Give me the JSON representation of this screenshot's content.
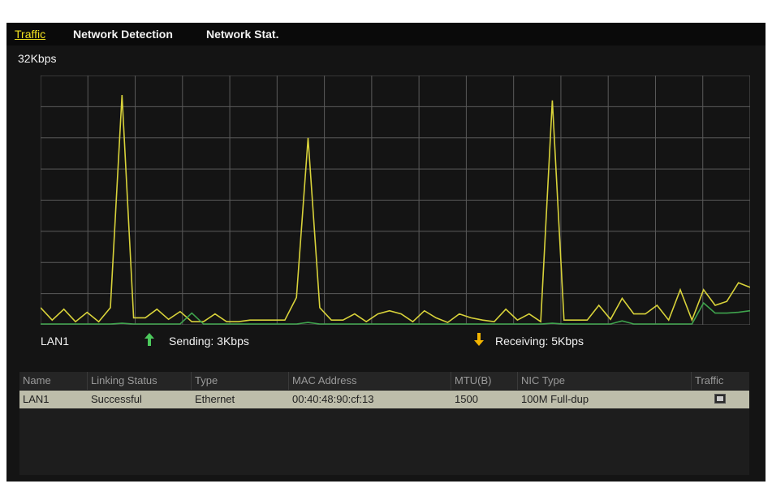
{
  "tabs": [
    {
      "label": "Traffic",
      "active": true
    },
    {
      "label": "Network Detection",
      "active": false
    },
    {
      "label": "Network Stat.",
      "active": false
    }
  ],
  "traffic": {
    "scale_label": "32Kbps",
    "interface": "LAN1",
    "sending_label": "Sending: 3Kbps",
    "receiving_label": "Receiving: 5Kbps",
    "sending_arrow_icon": "arrow-up-icon",
    "receiving_arrow_icon": "arrow-down-icon"
  },
  "chart_data": {
    "type": "line",
    "ylim": [
      0,
      32
    ],
    "y_unit": "Kbps",
    "x_count": 45,
    "grid": true,
    "series": [
      {
        "color": "#d8d23a",
        "values": [
          2.2,
          0.6,
          2.0,
          0.4,
          1.6,
          0.4,
          2.2,
          29.5,
          0.9,
          0.9,
          2.0,
          0.7,
          1.7,
          0.4,
          0.4,
          1.4,
          0.4,
          0.4,
          0.6,
          0.6,
          0.6,
          0.6,
          3.5,
          24.0,
          2.2,
          0.6,
          0.6,
          1.4,
          0.4,
          1.4,
          1.8,
          1.4,
          0.4,
          1.8,
          0.9,
          0.3,
          1.4,
          0.9,
          0.6,
          0.4,
          2.0,
          0.6,
          1.4,
          0.4,
          28.8
        ]
      },
      {
        "color": "#3fa34d",
        "values": [
          0.1,
          0.1,
          0.1,
          0.1,
          0.1,
          0.1,
          0.1,
          0.2,
          0.1,
          0.1,
          0.1,
          0.1,
          0.1,
          1.5,
          0.1,
          0.1,
          0.1,
          0.1,
          0.1,
          0.1,
          0.1,
          0.1,
          0.1,
          0.3,
          0.1,
          0.1,
          0.1,
          0.1,
          0.1,
          0.1,
          0.1,
          0.1,
          0.1,
          0.1,
          0.1,
          0.1,
          0.1,
          0.1,
          0.1,
          0.1,
          0.1,
          0.1,
          0.1,
          0.1,
          0.2
        ]
      }
    ],
    "series_tail": [
      {
        "values_yellow": [
          0.6,
          0.6,
          0.6,
          2.5,
          0.7,
          3.4,
          1.4,
          1.4,
          2.5,
          0.6,
          4.5,
          0.6,
          4.5,
          2.5,
          3.0,
          5.4,
          4.8
        ]
      },
      {
        "values_green": [
          0.1,
          0.1,
          0.1,
          0.1,
          0.1,
          0.5,
          0.1,
          0.1,
          0.1,
          0.1,
          0.1,
          0.1,
          2.8,
          1.5,
          1.5,
          1.6,
          1.8
        ]
      }
    ]
  },
  "nic_table": {
    "headers": [
      "Name",
      "Linking Status",
      "Type",
      "MAC Address",
      "MTU(B)",
      "NIC Type",
      "Traffic"
    ],
    "rows": [
      {
        "name": "LAN1",
        "status": "Successful",
        "type": "Ethernet",
        "mac": "00:40:48:90:cf:13",
        "mtu": "1500",
        "nic_type": "100M Full-dup",
        "traffic_icon": "traffic-chart-icon"
      }
    ]
  }
}
